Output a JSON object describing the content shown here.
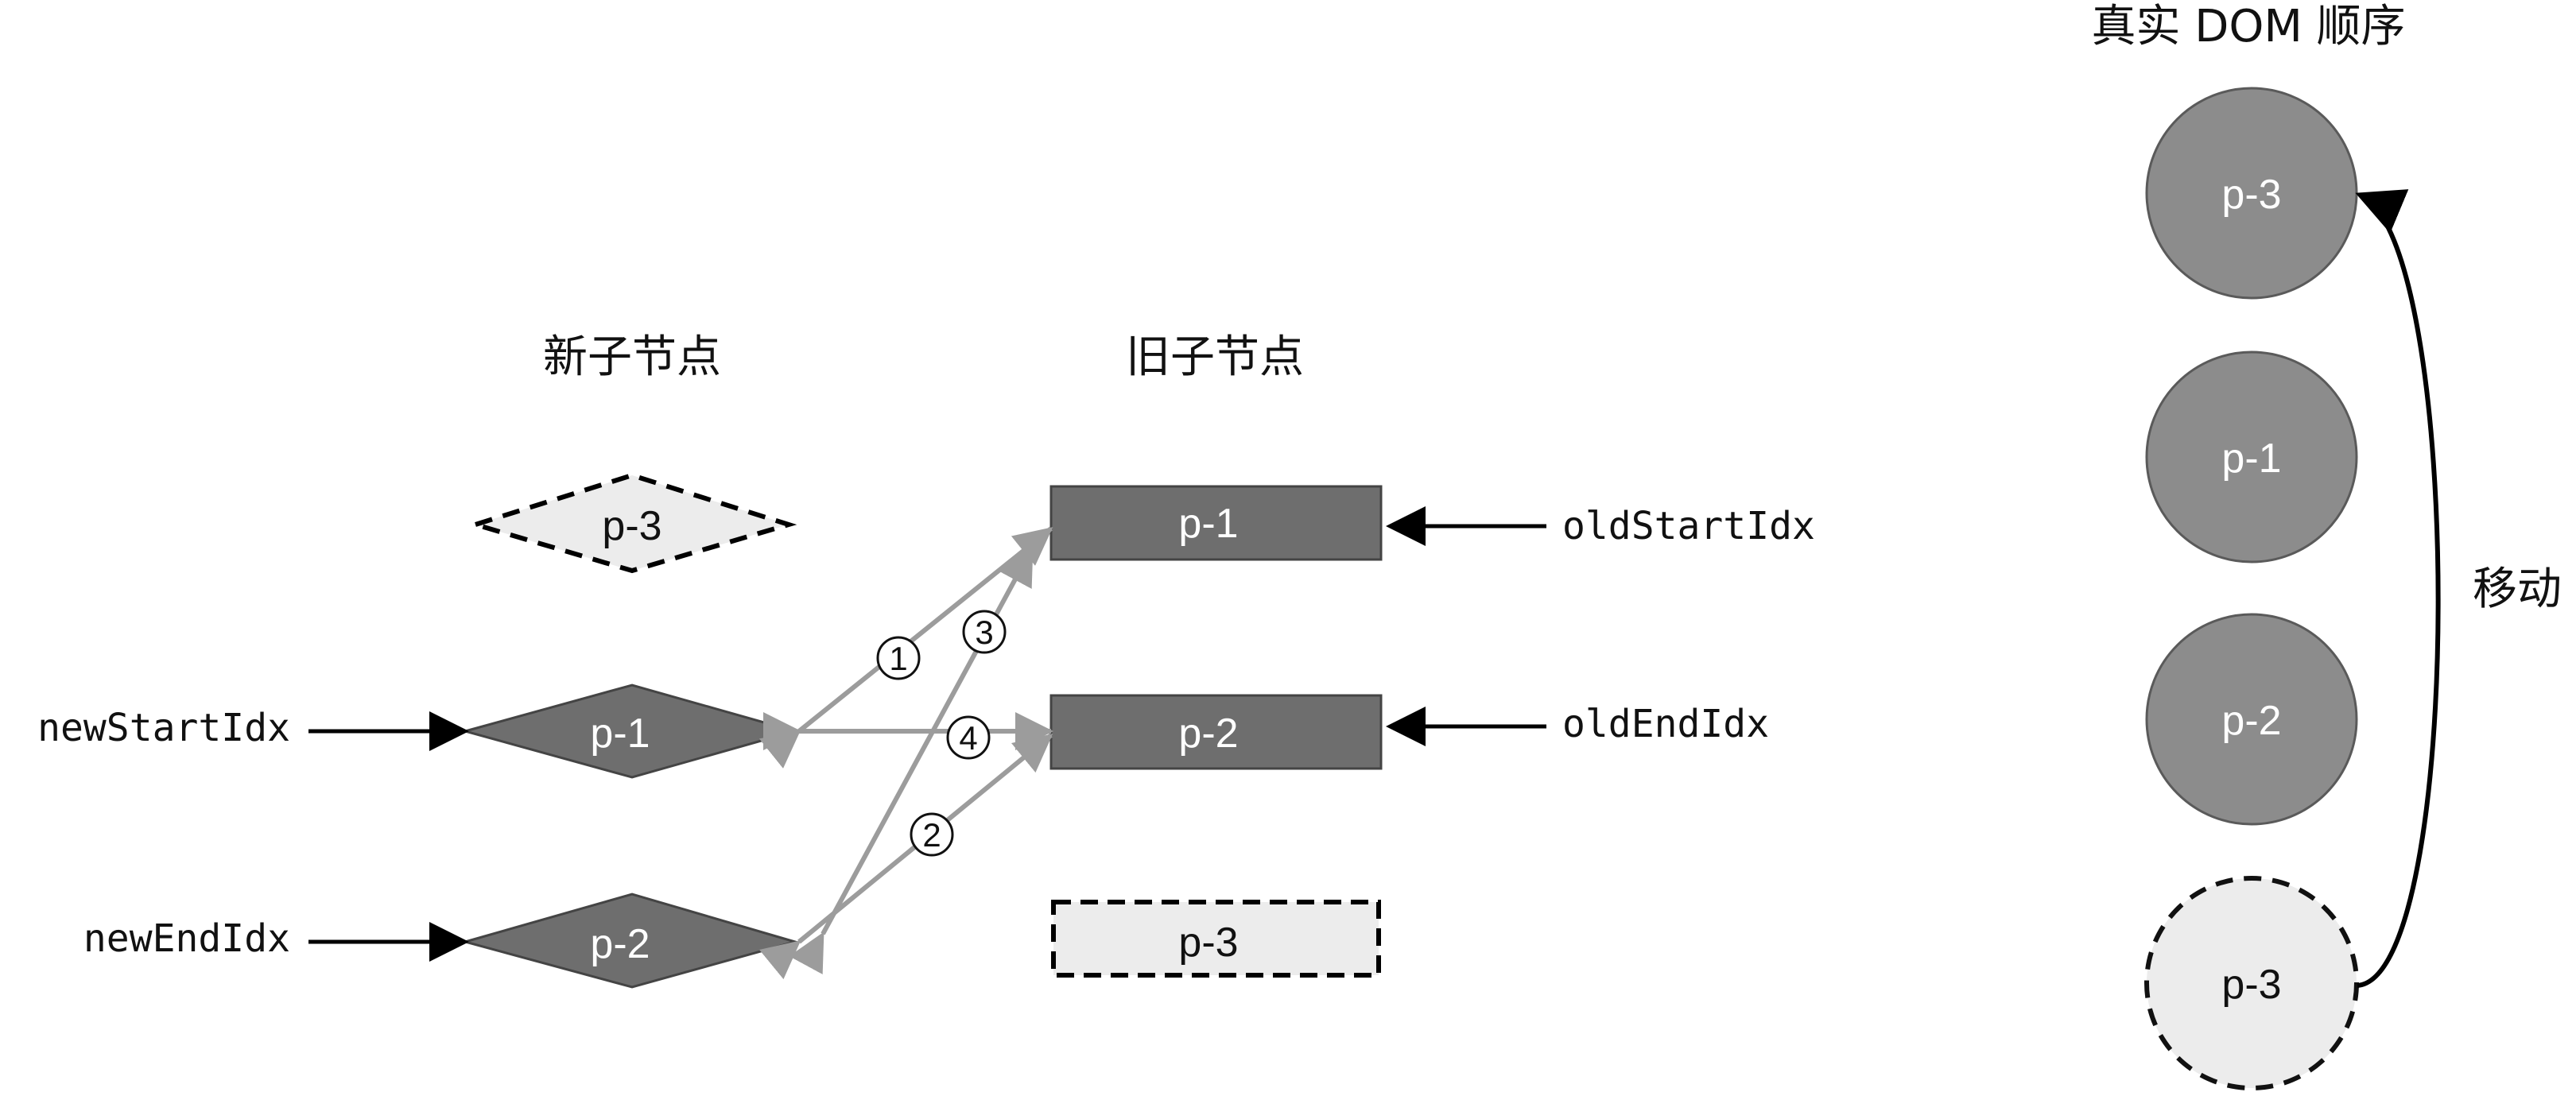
{
  "titles": {
    "new_children": "新子节点",
    "old_children": "旧子节点",
    "real_dom_order": "真实 DOM 顺序"
  },
  "new_children": {
    "ghost": "p-3",
    "start": "p-1",
    "end": "p-2"
  },
  "old_children": {
    "start": "p-1",
    "end": "p-2",
    "ghost": "p-3"
  },
  "pointers": {
    "new_start": "newStartIdx",
    "new_end": "newEndIdx",
    "old_start": "oldStartIdx",
    "old_end": "oldEndIdx"
  },
  "comparison_steps": {
    "one": "1",
    "two": "2",
    "three": "3",
    "four": "4"
  },
  "real_dom": {
    "nodes": [
      "p-3",
      "p-1",
      "p-2",
      "p-3"
    ],
    "move_label": "移动"
  },
  "colors": {
    "node_dark": "#6e6e6e",
    "node_light": "#ececec",
    "dom_circle": "#8c8c8c",
    "compare_arrow": "#9c9c9c",
    "pointer_arrow": "#000000",
    "text_light": "#ffffff",
    "text_dark": "#111111"
  }
}
